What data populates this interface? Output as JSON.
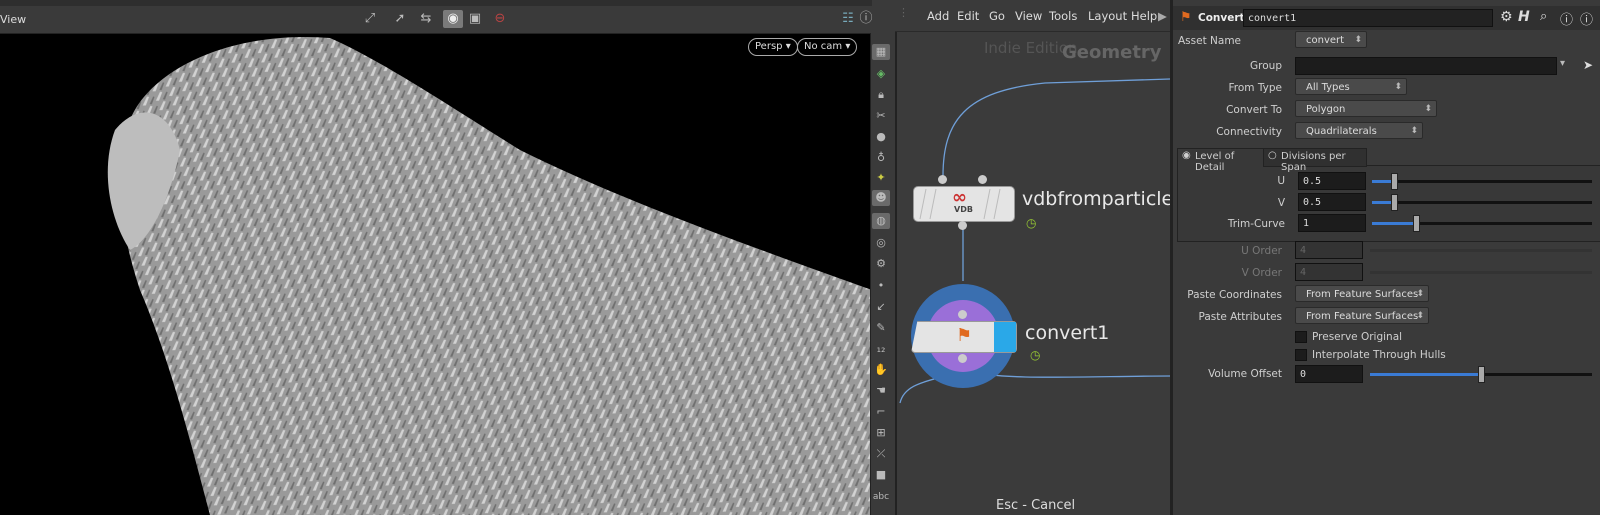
{
  "viewport": {
    "title": "View",
    "persp_label": "Persp",
    "cam_label": "No cam",
    "toolbar_icons": [
      "select-pose-icon",
      "select-icon",
      "transform-icon",
      "display-mode-icon",
      "camera-icon",
      "record-icon",
      "layout-icon",
      "help-icon"
    ],
    "side_icons": [
      "wireframe-icon",
      "shaded-icon",
      "lock-icon",
      "ghost-icon",
      "sphere-icon",
      "light-icon",
      "bulb-icon",
      "camera-view-icon",
      "render-icon",
      "snap-icon",
      "handle-icon",
      "point-icon",
      "brush-icon",
      "pen-icon",
      "number-icon",
      "paint-icon",
      "sculpt-icon",
      "ruler-icon",
      "grid-icon",
      "bone-icon",
      "stop-icon"
    ],
    "side_footer": "abc"
  },
  "network": {
    "menu": [
      "Add",
      "Edit",
      "Go",
      "View",
      "Tools",
      "Layout",
      "Help"
    ],
    "watermark_edition": "Indie Edition",
    "watermark_context": "Geometry",
    "nodes": [
      {
        "name": "vdbfromparticle",
        "badge": "VDB"
      },
      {
        "name": "convert1"
      }
    ],
    "status": "Esc - Cancel"
  },
  "params": {
    "header_type": "Convert",
    "header_name": "convert1",
    "asset_name_label": "Asset Name",
    "asset_name_value": "convert",
    "rows": {
      "group": {
        "label": "Group",
        "value": ""
      },
      "from_type": {
        "label": "From Type",
        "value": "All Types"
      },
      "convert_to": {
        "label": "Convert To",
        "value": "Polygon"
      },
      "connectivity": {
        "label": "Connectivity",
        "value": "Quadrilaterals"
      },
      "u": {
        "label": "U",
        "value": "0.5",
        "fraction": 0.1
      },
      "v": {
        "label": "V",
        "value": "0.5",
        "fraction": 0.1
      },
      "trim_curve": {
        "label": "Trim-Curve",
        "value": "1",
        "fraction": 0.2
      },
      "u_order": {
        "label": "U Order",
        "value": "4"
      },
      "v_order": {
        "label": "V Order",
        "value": "4"
      },
      "paste_coords": {
        "label": "Paste Coordinates",
        "value": "From Feature Surfaces"
      },
      "paste_attrs": {
        "label": "Paste Attributes",
        "value": "From Feature Surfaces"
      },
      "preserve_original": {
        "label": "Preserve Original",
        "checked": false
      },
      "interp_hulls": {
        "label": "Interpolate Through Hulls",
        "checked": false
      },
      "volume_offset": {
        "label": "Volume Offset",
        "value": "0",
        "fraction": 0.5
      }
    },
    "tabs": [
      {
        "label": "Level of Detail",
        "selected": true
      },
      {
        "label": "Divisions per Span",
        "selected": false
      }
    ],
    "accent_color": "#3a7bd5"
  }
}
